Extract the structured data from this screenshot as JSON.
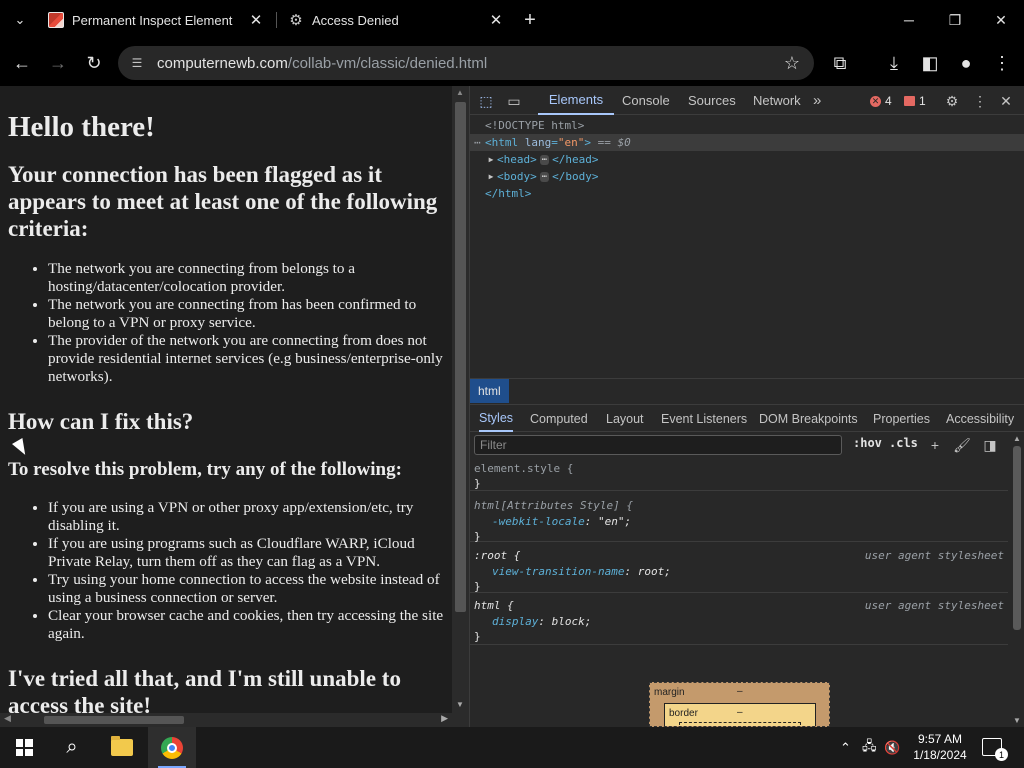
{
  "browser": {
    "tabs": [
      {
        "title": "Permanent Inspect Element",
        "favicon": "pie-chart-icon",
        "active": true
      },
      {
        "title": "Access Denied",
        "favicon": "gear-icon",
        "active": false
      }
    ],
    "url_host": "computernewb.com",
    "url_path": "/collab-vm/classic/denied.html"
  },
  "page": {
    "h1": "Hello there!",
    "h2_flagged": "Your connection has been flagged as it appears to meet at least one of the following criteria:",
    "criteria": [
      "The network you are connecting from belongs to a hosting/datacenter/colocation provider.",
      "The network you are connecting from has been confirmed to belong to a VPN or proxy service.",
      "The provider of the network you are connecting from does not provide residential internet services (e.g business/enterprise-only networks)."
    ],
    "h2_fix": "How can I fix this?",
    "h3_resolve": "To resolve this problem, try any of the following:",
    "fixes": [
      "If you are using a VPN or other proxy app/extension/etc, try disabling it.",
      "If you are using programs such as Cloudflare WARP, iCloud Private Relay, turn them off as they can flag as a VPN.",
      "Try using your home connection to access the website instead of using a business connection or server.",
      "Clear your browser cache and cookies, then try accessing the site again."
    ],
    "h2_tried": "I've tried all that, and I'm still unable to access the site!"
  },
  "devtools": {
    "tabs": [
      "Elements",
      "Console",
      "Sources",
      "Network"
    ],
    "more": "»",
    "errors_count": "4",
    "issues_count": "1",
    "dom": {
      "doctype": "<!DOCTYPE html>",
      "html_open": "<html",
      "lang_attr": "lang",
      "lang_val": "\"en\"",
      "html_close_bracket": ">",
      "eq_hint": "== $0",
      "head_open": "<head>",
      "head_close": "</head>",
      "body_open": "<body>",
      "body_close": "</body>",
      "html_end": "</html>"
    },
    "breadcrumb": "html",
    "sub_tabs": [
      "Styles",
      "Computed",
      "Layout",
      "Event Listeners",
      "DOM Breakpoints",
      "Properties",
      "Accessibility"
    ],
    "filter_placeholder": "Filter",
    "hov": ":hov",
    "cls": ".cls",
    "rules": [
      {
        "selector": "element.style {",
        "close": "}"
      },
      {
        "selector": "html[Attributes Style] {",
        "prop": "-webkit-locale",
        "value": "\"en\";",
        "close": "}"
      },
      {
        "selector": ":root {",
        "prop": "view-transition-name",
        "value": "root;",
        "close": "}",
        "origin": "user agent stylesheet"
      },
      {
        "selector": "html {",
        "prop": "display",
        "value": "block;",
        "close": "}",
        "origin": "user agent stylesheet"
      }
    ],
    "boxmodel": {
      "margin_label": "margin",
      "margin_value": "–",
      "border_label": "border",
      "border_value": "–"
    }
  },
  "taskbar": {
    "time": "9:57 AM",
    "date": "1/18/2024",
    "notification_count": "1"
  }
}
